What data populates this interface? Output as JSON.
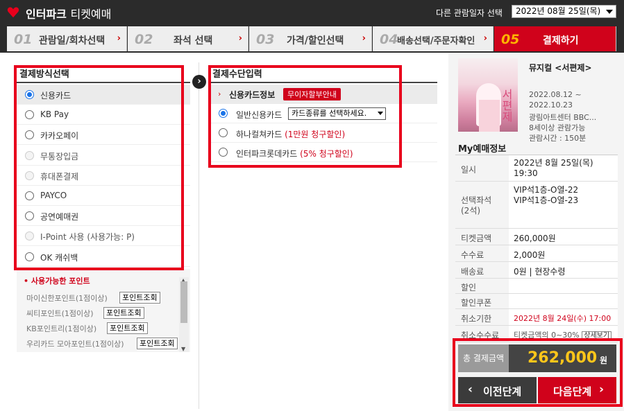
{
  "header": {
    "brand": "인터파크",
    "brand_sub": "티켓예매",
    "date_label": "다른 관람일자 선택",
    "date_value": "2022년 08월 25일(목)"
  },
  "steps": [
    {
      "num": "01",
      "label": "관람일/회차선택",
      "arrow": "›"
    },
    {
      "num": "02",
      "label": "좌석 선택",
      "arrow": "›"
    },
    {
      "num": "03",
      "label": "가격/할인선택",
      "arrow": "›"
    },
    {
      "num": "04",
      "label": "배송선택/주문자확인",
      "arrow": "›"
    },
    {
      "num": "05",
      "label": "결제하기"
    }
  ],
  "payment_methods": {
    "title": "결제방식선택",
    "items": [
      {
        "label": "신용카드",
        "state": "selected"
      },
      {
        "label": "KB Pay",
        "state": "enabled"
      },
      {
        "label": "카카오페이",
        "state": "enabled"
      },
      {
        "label": "무통장입금",
        "state": "disabled"
      },
      {
        "label": "휴대폰결제",
        "state": "disabled"
      },
      {
        "label": "PAYCO",
        "state": "enabled"
      },
      {
        "label": "공연예매권",
        "state": "enabled"
      },
      {
        "label": "I-Point 사용 (사용가능: P)",
        "state": "disabled"
      },
      {
        "label": "OK 캐쉬백",
        "state": "enabled"
      }
    ]
  },
  "points": {
    "title": "사용가능한 포인트",
    "rows": [
      {
        "label": "마이신한포인트(1점이상)",
        "button": "포인트조회"
      },
      {
        "label": "씨티포인트(1점이상)",
        "button": "포인트조회"
      },
      {
        "label": "KB포인트리(1점이상)",
        "button": "포인트조회"
      },
      {
        "label": "우리카드 모아포인트(1점이상)",
        "button": "포인트조회"
      }
    ]
  },
  "payment_input": {
    "title": "결제수단입력",
    "card_info_label": "신용카드정보",
    "badge": "무이자할부안내",
    "options": [
      {
        "label": "일반신용카드",
        "red": "",
        "selected": true
      },
      {
        "label": "하나컬쳐카드",
        "red": "(1만원 청구할인)",
        "selected": false
      },
      {
        "label": "인터파크롯데카드",
        "red": "(5% 청구할인)",
        "selected": false
      }
    ],
    "card_select_value": "카드종류를 선택하세요."
  },
  "show": {
    "title": "뮤지컬 <서편제>",
    "period_start": "2022.08.12 ~",
    "period_end": "2022.10.23",
    "venue": "광림아트센터 BBC...",
    "age": "8세이상 관람가능",
    "runtime": "관람시간 : 150분",
    "poster_text": "서편제"
  },
  "my_booking": {
    "title": "My예매정보",
    "rows": [
      {
        "key": "일시",
        "value": [
          "2022년 8월 25일(목)",
          "19:30"
        ]
      },
      {
        "key": "선택좌석\n(2석)",
        "value": [
          "VIP석1층-O열-22",
          "VIP석1층-O열-23"
        ]
      },
      {
        "key": "티켓금액",
        "value": [
          "260,000원"
        ]
      },
      {
        "key": "수수료",
        "value": [
          "2,000원"
        ]
      },
      {
        "key": "배송료",
        "value": [
          "0원 | 현장수령"
        ]
      },
      {
        "key": "할인",
        "value": [
          ""
        ]
      },
      {
        "key": "할인쿠폰",
        "value": [
          ""
        ]
      },
      {
        "key": "취소기한",
        "value": [
          "2022년 8월 24일(수) 17:00"
        ],
        "red": true
      },
      {
        "key": "취소수수료",
        "value": [
          "티켓금액의 0~30%"
        ],
        "button": "상세보기"
      }
    ]
  },
  "total": {
    "label": "총 결제금액",
    "amount": "262,000",
    "unit": "원"
  },
  "nav": {
    "prev": "이전단계",
    "next": "다음단계"
  }
}
